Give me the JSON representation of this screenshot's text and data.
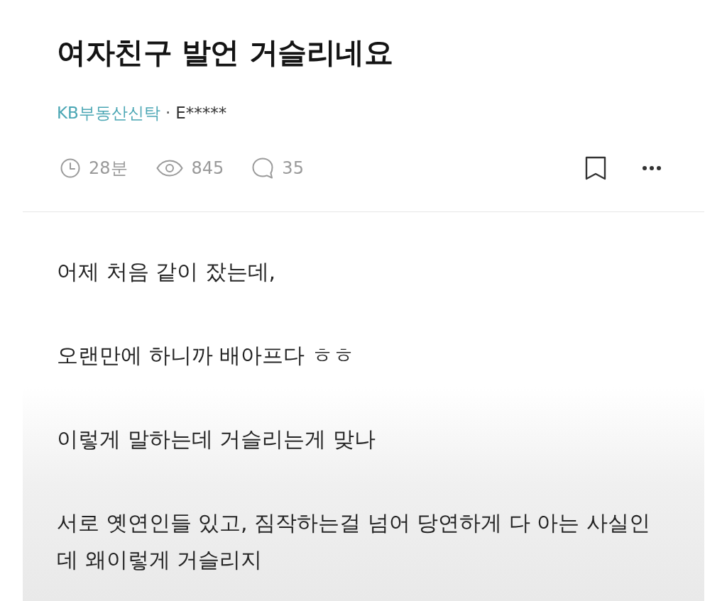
{
  "post": {
    "title": "여자친구 발언 거슬리네요",
    "board": "KB부동산신탁",
    "separator": "·",
    "author": "E*****",
    "stats": [
      {
        "kind": "time",
        "text": "28분"
      },
      {
        "kind": "views",
        "text": "845"
      },
      {
        "kind": "comments",
        "text": "35"
      }
    ]
  },
  "body": {
    "paragraphs": [
      "어제 처음 같이 잤는데,",
      "오랜만에 하니까 배아프다 ㅎㅎ",
      "이렇게 말하는데 거슬리는게 맞나",
      "서로 옛연인들 있고, 짐작하는걸 넘어 당연하게 다 아는 사실인데 왜이렇게 거슬리지"
    ]
  }
}
